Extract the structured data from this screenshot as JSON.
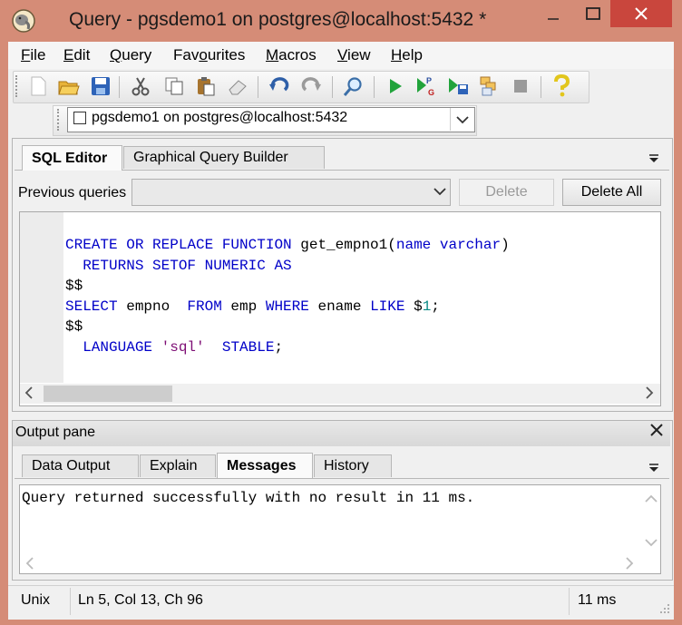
{
  "window": {
    "title": "Query - pgsdemo1 on postgres@localhost:5432 *"
  },
  "menu": {
    "file": {
      "key": "F",
      "rest": "ile"
    },
    "edit": {
      "key": "E",
      "rest": "dit"
    },
    "query": {
      "key": "Q",
      "rest": "uery"
    },
    "favourites": {
      "pre": "Fav",
      "key": "o",
      "rest": "urites"
    },
    "macros": {
      "key": "M",
      "rest": "acros"
    },
    "view": {
      "key": "V",
      "rest": "iew"
    },
    "help": {
      "key": "H",
      "rest": "elp"
    }
  },
  "connection": {
    "value": "pgsdemo1 on postgres@localhost:5432"
  },
  "editor_tabs": [
    "SQL Editor",
    "Graphical Query Builder"
  ],
  "previous_queries": {
    "label": "Previous queries",
    "value": ""
  },
  "buttons": {
    "delete": "Delete",
    "delete_all": "Delete All"
  },
  "sql": {
    "l1_kw": "CREATE OR REPLACE FUNCTION",
    "l1_name": " get_empno1(",
    "l1_arg": "name varchar",
    "l1_close": ")",
    "l2_kw": "  RETURNS SETOF NUMERIC AS",
    "l3": "$$",
    "l4_kw1": "SELECT",
    "l4_col": " empno  ",
    "l4_kw2": "FROM",
    "l4_tbl": " emp ",
    "l4_kw3": "WHERE",
    "l4_col2": " ename ",
    "l4_kw4": "LIKE",
    "l4_param": " $",
    "l4_num": "1",
    "l4_end": ";",
    "l5": "$$",
    "l6_kw": "  LANGUAGE ",
    "l6_str": "'sql'",
    "l6_kw2": "  STABLE",
    "l6_end": ";"
  },
  "output": {
    "title": "Output pane",
    "tabs": [
      "Data Output",
      "Explain",
      "Messages",
      "History"
    ],
    "message": "Query returned successfully with no result in 11 ms."
  },
  "status": {
    "encoding": "Unix",
    "position": "Ln 5, Col 13, Ch 96",
    "time": "11 ms"
  },
  "colors": {
    "titlebar": "#d58c77",
    "close": "#c9463d",
    "keyword": "#0000c8",
    "string": "#7d0d74",
    "number": "#0a8a85"
  }
}
